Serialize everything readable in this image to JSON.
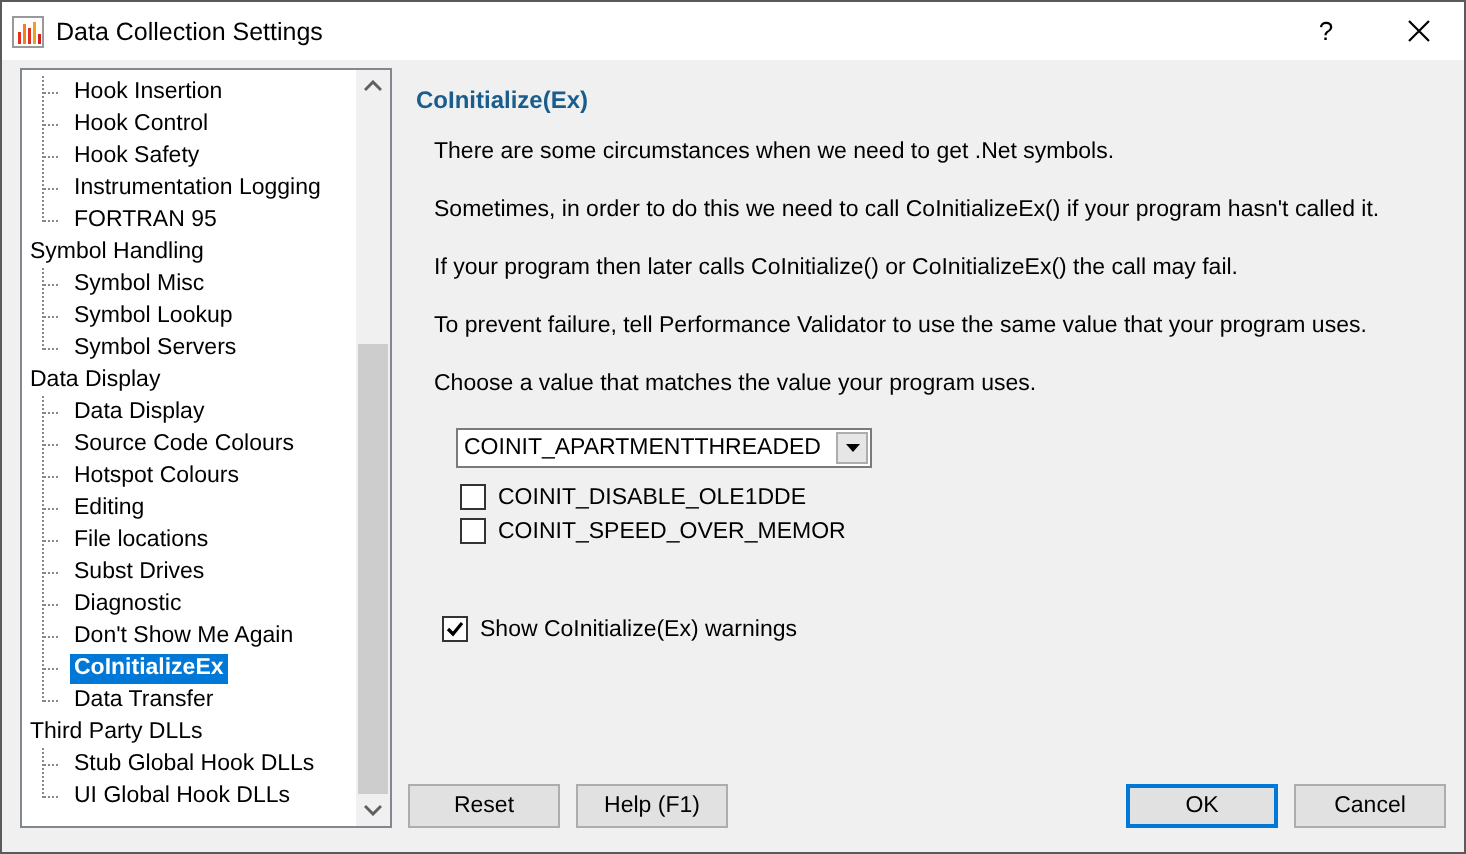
{
  "window": {
    "title": "Data Collection Settings",
    "help_glyph": "?"
  },
  "tree": [
    {
      "children": [
        {
          "label": "Hook Insertion",
          "selected": false
        },
        {
          "label": "Hook Control",
          "selected": false
        },
        {
          "label": "Hook Safety",
          "selected": false
        },
        {
          "label": "Instrumentation Logging",
          "selected": false
        },
        {
          "label": "FORTRAN 95",
          "selected": false
        }
      ]
    },
    {
      "label": "Symbol Handling",
      "selected": false,
      "children": [
        {
          "label": "Symbol Misc",
          "selected": false
        },
        {
          "label": "Symbol Lookup",
          "selected": false
        },
        {
          "label": "Symbol Servers",
          "selected": false
        }
      ]
    },
    {
      "label": "Data Display",
      "selected": false,
      "children": [
        {
          "label": "Data Display",
          "selected": false
        },
        {
          "label": "Source Code Colours",
          "selected": false
        },
        {
          "label": "Hotspot Colours",
          "selected": false
        },
        {
          "label": "Editing",
          "selected": false
        },
        {
          "label": "File locations",
          "selected": false
        },
        {
          "label": "Subst Drives",
          "selected": false
        },
        {
          "label": "Diagnostic",
          "selected": false
        },
        {
          "label": "Don't Show Me Again",
          "selected": false
        },
        {
          "label": "CoInitializeEx",
          "selected": true
        },
        {
          "label": "Data Transfer",
          "selected": false
        }
      ]
    },
    {
      "label": "Third Party DLLs",
      "selected": false,
      "children": [
        {
          "label": "Stub Global Hook DLLs",
          "selected": false
        },
        {
          "label": "UI Global Hook DLLs",
          "selected": false
        }
      ]
    }
  ],
  "panel": {
    "heading": "CoInitialize(Ex)",
    "paragraphs": [
      "There are some circumstances when we need to get .Net symbols.",
      "Sometimes, in order to do this we need to call CoInitializeEx() if your program hasn't called it.",
      "If your program then later calls CoInitialize() or CoInitializeEx() the call may fail.",
      "To prevent failure, tell Performance Validator to use the same value that your program uses.",
      "Choose a value that matches the value your program uses."
    ],
    "dropdown": {
      "value": "COINIT_APARTMENTTHREADED"
    },
    "options": [
      {
        "label": "COINIT_DISABLE_OLE1DDE",
        "checked": false
      },
      {
        "label": "COINIT_SPEED_OVER_MEMOR",
        "checked": false
      }
    ],
    "warnings": {
      "label": "Show CoInitialize(Ex) warnings",
      "checked": true
    }
  },
  "buttons": [
    {
      "label": "Reset",
      "default": false
    },
    {
      "label": "Help (F1)",
      "default": false
    },
    {
      "label": "OK",
      "default": true
    },
    {
      "label": "Cancel",
      "default": false
    }
  ]
}
